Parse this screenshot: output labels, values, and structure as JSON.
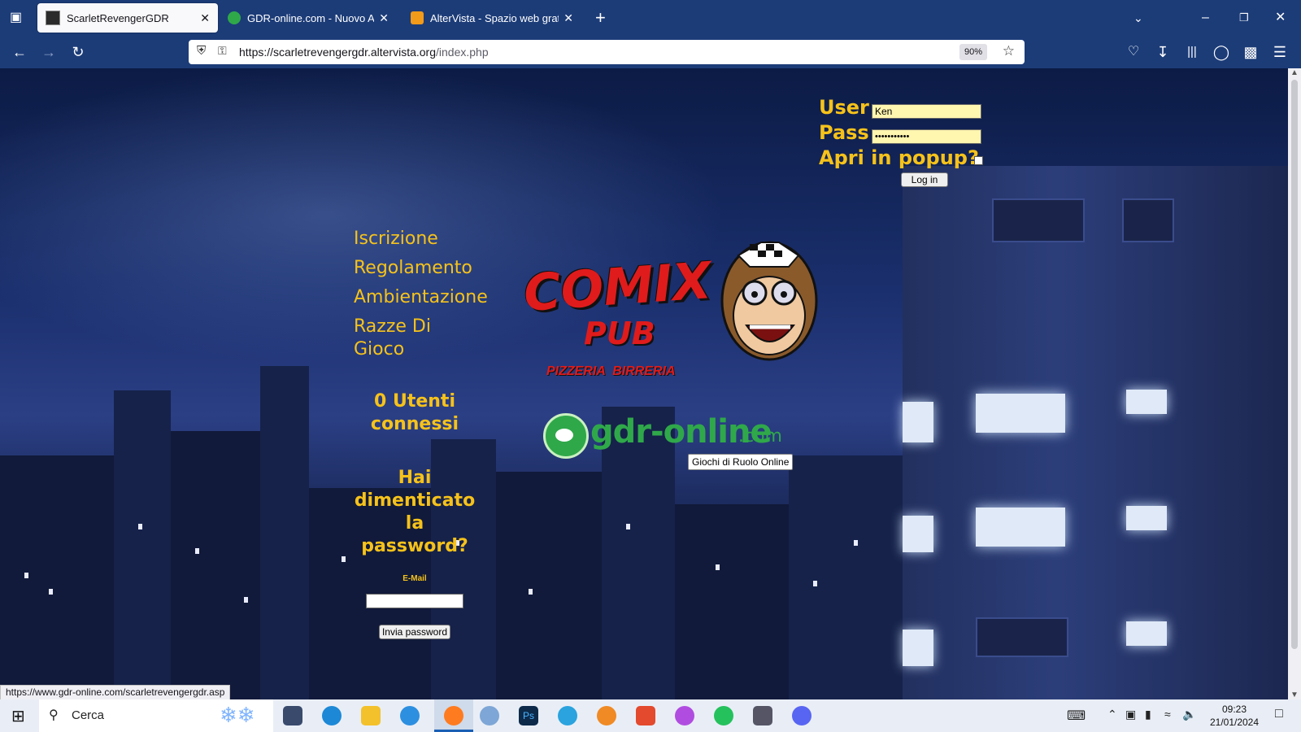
{
  "tabs": [
    {
      "title": "ScarletRevengerGDR",
      "active": true,
      "favicon_color": "#2b2b2b"
    },
    {
      "title": "GDR-online.com - Nuovo Annu",
      "active": false,
      "favicon_color": "#2fa84a"
    },
    {
      "title": "AlterVista - Spazio web gratis",
      "active": false,
      "favicon_color": "#f29a1a"
    }
  ],
  "url": {
    "host": "https://scarletrevengergdr.altervista.org",
    "path": "/index.php"
  },
  "zoom": "90%",
  "login": {
    "user_label": "User",
    "user_value": "Ken",
    "pass_label": "Pass",
    "pass_value": "•••••••••••",
    "popup_label": "Apri in popup?",
    "login_button": "Log in"
  },
  "menu": [
    "Iscrizione",
    "Regolamento",
    "Ambientazione",
    "Razze Di\nGioco"
  ],
  "online_users": "0 Utenti connessi",
  "forgot": {
    "title": "Hai dimenticato la password?",
    "email_label": "E-Mail",
    "email_value": "",
    "submit_label": "Invia password"
  },
  "logo": {
    "line1": "COMIX",
    "line2": "PUB",
    "line3": "PIZZERIA  BIRRERIA"
  },
  "gdr_banner": {
    "brand": "gdr-online",
    "suffix": ".com",
    "caption": "Giochi di Ruolo Online"
  },
  "status_url": "https://www.gdr-online.com/scarletrevengergdr.asp",
  "taskbar": {
    "search_placeholder": "Cerca",
    "time": "09:23",
    "date": "21/01/2024"
  },
  "colors": {
    "accent": "#f6c21a",
    "browser_chrome": "#1c3c78",
    "login_field": "#fff6b0"
  }
}
